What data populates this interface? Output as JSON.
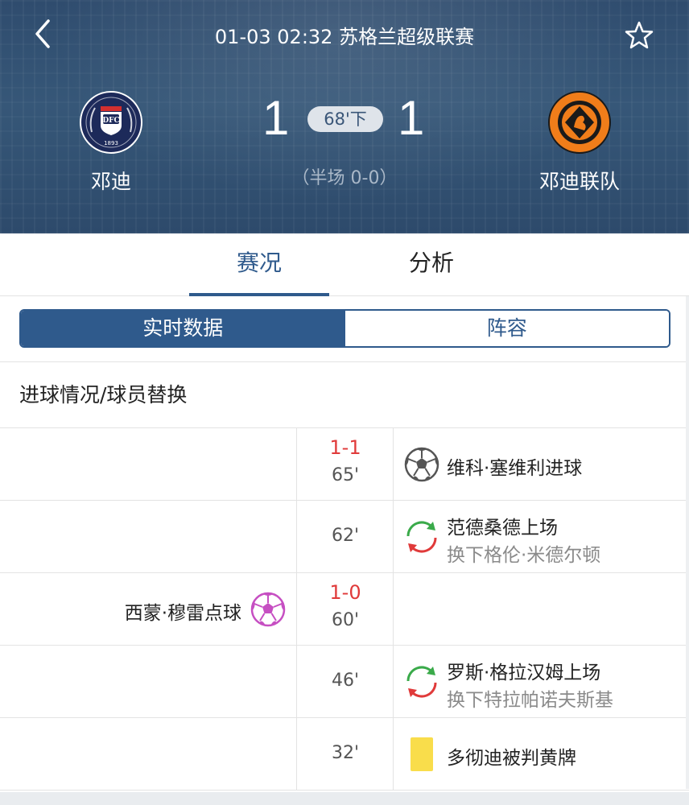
{
  "header": {
    "match_title": "01-03 02:32 苏格兰超级联赛",
    "home_team": "邓迪",
    "away_team": "邓迪联队",
    "home_score": "1",
    "away_score": "1",
    "minute": "68'下",
    "halftime": "（半场 0-0）",
    "crest_year": "1893"
  },
  "tabs": {
    "match": "赛况",
    "analysis": "分析"
  },
  "segment": {
    "live": "实时数据",
    "lineup": "阵容"
  },
  "section": {
    "title": "进球情况/球员替换"
  },
  "events": [
    {
      "score": "1-1",
      "minute": "65'",
      "right": {
        "icon": "soccer-ball-icon",
        "line1": "维科·塞维利进球"
      }
    },
    {
      "score": "",
      "minute": "62'",
      "right": {
        "icon": "substitution-icon",
        "line1": "范德桑德上场",
        "line2": "换下格伦·米德尔顿"
      }
    },
    {
      "score": "1-0",
      "minute": "60'",
      "left": {
        "icon": "penalty-ball-icon",
        "text": "西蒙·穆雷点球"
      }
    },
    {
      "score": "",
      "minute": "46'",
      "right": {
        "icon": "substitution-icon",
        "line1": "罗斯·格拉汉姆上场",
        "line2": "换下特拉帕诺夫斯基"
      }
    },
    {
      "score": "",
      "minute": "32'",
      "right": {
        "icon": "yellow-card-icon",
        "line1": "多彻迪被判黄牌"
      }
    }
  ],
  "colors": {
    "header_bg": "#365778",
    "accent": "#2f5a8c",
    "score_red": "#e03a3a",
    "yellow_card": "#f9dd4b",
    "penalty_pink": "#c64fc2"
  }
}
